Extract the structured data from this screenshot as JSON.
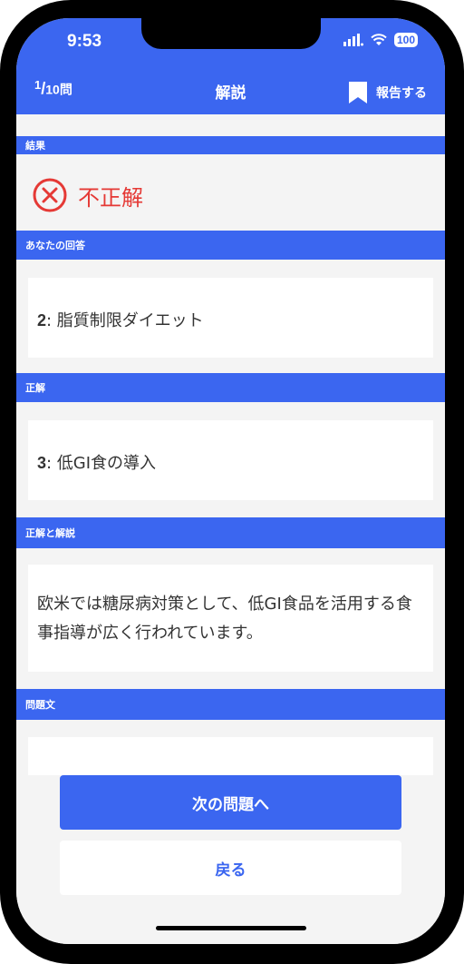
{
  "status_bar": {
    "time": "9:53",
    "battery": "100"
  },
  "header": {
    "progress_current": "1",
    "progress_total": "10",
    "progress_unit": "問",
    "title": "解説",
    "report_label": "報告する"
  },
  "sections": {
    "result_label": "結果",
    "result_text": "不正解",
    "your_answer_label": "あなたの回答",
    "your_answer_number": "2",
    "your_answer_text": ": 脂質制限ダイエット",
    "correct_label": "正解",
    "correct_number": "3",
    "correct_text": ": 低GI食の導入",
    "explanation_label": "正解と解説",
    "explanation_text": "欧米では糖尿病対策として、低GI食品を活用する食事指導が広く行われています。",
    "question_label": "問題文"
  },
  "buttons": {
    "next_label": "次の問題へ",
    "back_label": "戻る"
  },
  "colors": {
    "accent": "#3b66f0",
    "error": "#e53935",
    "background": "#f4f4f4"
  }
}
